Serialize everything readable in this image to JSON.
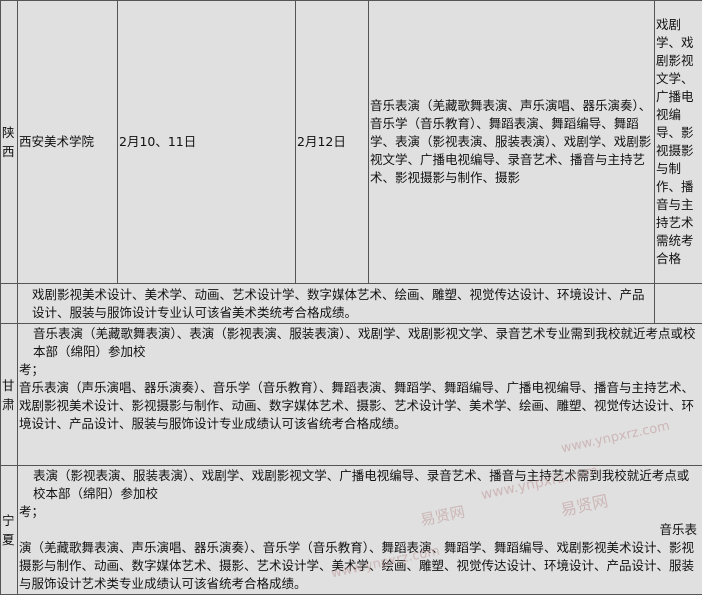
{
  "rows": {
    "shaanxi": {
      "province": "陕西",
      "school": "西安美术学院",
      "dates": "2月10、11日",
      "date2": "2月12日",
      "majors": "音乐表演（羌藏歌舞表演、声乐演唱、器乐演奏）、音乐学（音乐教育）、舞蹈表演、舞蹈编导、舞蹈学、表演（影视表演、服装表演）、戏剧学、戏剧影视文学、广播电视编导、录音艺术、播音与主持艺术、影视摄影与制作、摄影",
      "note": "戏剧学、戏剧影视文学、广播电视编导、影视摄影与制作、播音与主持艺术需统考合格",
      "art_text": "戏剧影视美术设计、美术学、动画、艺术设计学、数字媒体艺术、绘画、雕塑、视觉传达设计、环境设计、产品设计、服装与服饰设计专业认可该省美术类统考合格成绩。"
    },
    "gansu": {
      "province": "甘肃",
      "line1": "音乐表演（羌藏歌舞表演）、表演（影视表演、服装表演）、戏剧学、戏剧影视文学、录音艺术专业需到我校就近考点或校本部（绵阳）参加校",
      "line2": "考；",
      "line3": "音乐表演（声乐演唱、器乐演奏）、音乐学（音乐教育）、舞蹈表演、舞蹈学、舞蹈编导、广播电视编导、播音与主持艺术、戏剧影视美术设计、影视摄影与制作、动画、数字媒体艺术、摄影、艺术设计学、美术学、绘画、雕塑、视觉传达设计、环境设计、产品设计、服装与服饰设计专业成绩认可该省统考合格成绩。"
    },
    "ningxia": {
      "province": "宁夏",
      "line1": "表演（影视表演、服装表演）、戏剧学、戏剧影视文学、广播电视编导、录音艺术、播音与主持艺术需到我校就近考点或校本部（绵阳）参加校",
      "line2": "考；",
      "line3": "音乐表",
      "line4": "演（羌藏歌舞表演、声乐演唱、器乐演奏）、音乐学（音乐教育）、舞蹈表演、舞蹈学、舞蹈编导、戏剧影视美术设计、影视摄影与制作、动画、数字媒体艺术、摄影、艺术设计学、美术学、绘画、雕塑、视觉传达设计、环境设计、产品设计、服装与服饰设计艺术类专业成绩认可该省统考合格成绩。"
    }
  },
  "watermarks": [
    "www.ynpxrz.com",
    "易贤网",
    "www.ynpxrz.com",
    "易贤网",
    "www.ynpxrz.com"
  ]
}
